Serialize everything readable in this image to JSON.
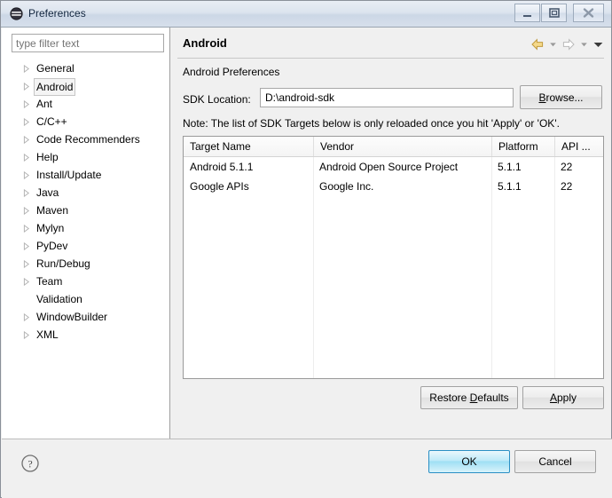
{
  "window": {
    "title": "Preferences",
    "icon": "preferences-icon",
    "controls": {
      "minimize": "minimize-button",
      "maximize": "maximize-button",
      "close": "close-button"
    }
  },
  "sidebar": {
    "filter": {
      "value": "",
      "placeholder": "type filter text"
    },
    "items": [
      {
        "label": "General",
        "expandable": true,
        "selected": false
      },
      {
        "label": "Android",
        "expandable": true,
        "selected": true
      },
      {
        "label": "Ant",
        "expandable": true,
        "selected": false
      },
      {
        "label": "C/C++",
        "expandable": true,
        "selected": false
      },
      {
        "label": "Code Recommenders",
        "expandable": true,
        "selected": false
      },
      {
        "label": "Help",
        "expandable": true,
        "selected": false
      },
      {
        "label": "Install/Update",
        "expandable": true,
        "selected": false
      },
      {
        "label": "Java",
        "expandable": true,
        "selected": false
      },
      {
        "label": "Maven",
        "expandable": true,
        "selected": false
      },
      {
        "label": "Mylyn",
        "expandable": true,
        "selected": false
      },
      {
        "label": "PyDev",
        "expandable": true,
        "selected": false
      },
      {
        "label": "Run/Debug",
        "expandable": true,
        "selected": false
      },
      {
        "label": "Team",
        "expandable": true,
        "selected": false
      },
      {
        "label": "Validation",
        "expandable": false,
        "selected": false
      },
      {
        "label": "WindowBuilder",
        "expandable": true,
        "selected": false
      },
      {
        "label": "XML",
        "expandable": true,
        "selected": false
      }
    ]
  },
  "page": {
    "title": "Android",
    "subtitle": "Android Preferences",
    "nav": {
      "back": "back-arrow-icon",
      "back_menu": "back-dropdown-icon",
      "forward": "forward-arrow-icon",
      "forward_menu": "forward-dropdown-icon",
      "menu": "view-menu-icon"
    },
    "sdk": {
      "label": "SDK Location:",
      "value": "D:\\android-sdk",
      "placeholder": "",
      "browse_label": "Browse...",
      "browse_mnemonic": "B"
    },
    "note": "Note: The list of SDK Targets below is only reloaded once you hit 'Apply' or 'OK'.",
    "table": {
      "columns": [
        "Target Name",
        "Vendor",
        "Platform",
        "API ..."
      ],
      "rows": [
        [
          "Android 5.1.1",
          "Android Open Source Project",
          "5.1.1",
          "22"
        ],
        [
          "Google APIs",
          "Google Inc.",
          "5.1.1",
          "22"
        ]
      ]
    },
    "buttons": {
      "restore_defaults": "Restore Defaults",
      "restore_mnemonic": "D",
      "apply": "Apply",
      "apply_mnemonic": "A"
    }
  },
  "footer": {
    "help": "help-icon",
    "ok": "OK",
    "cancel": "Cancel"
  },
  "colors": {
    "accent": "#2a8fc4",
    "title_gradient_top": "#e8edf4",
    "title_gradient_bottom": "#d6dfeb",
    "panel_bg": "#f0f0f0",
    "field_bg": "#ffffff",
    "back_arrow": "#f2c14e"
  }
}
